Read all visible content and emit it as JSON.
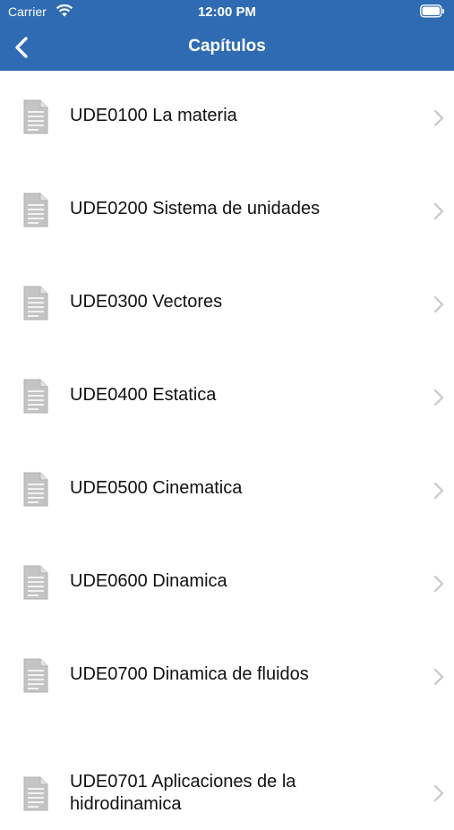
{
  "status_bar": {
    "carrier": "Carrier",
    "time": "12:00 PM"
  },
  "nav": {
    "title": "Capítulos",
    "back_icon": "chevron-left-icon"
  },
  "colors": {
    "header_bg": "#2f6bb3",
    "chevron": "#c7c7cc",
    "doc_icon": "#b9b9b9"
  },
  "chapters": [
    {
      "label": "UDE0100  La materia"
    },
    {
      "label": "UDE0200  Sistema de unidades"
    },
    {
      "label": "UDE0300  Vectores"
    },
    {
      "label": "UDE0400  Estatica"
    },
    {
      "label": "UDE0500  Cinematica"
    },
    {
      "label": "UDE0600  Dinamica"
    },
    {
      "label": "UDE0700  Dinamica de fluidos"
    },
    {
      "label": "UDE0701  Aplicaciones de la hidrodinamica"
    }
  ]
}
